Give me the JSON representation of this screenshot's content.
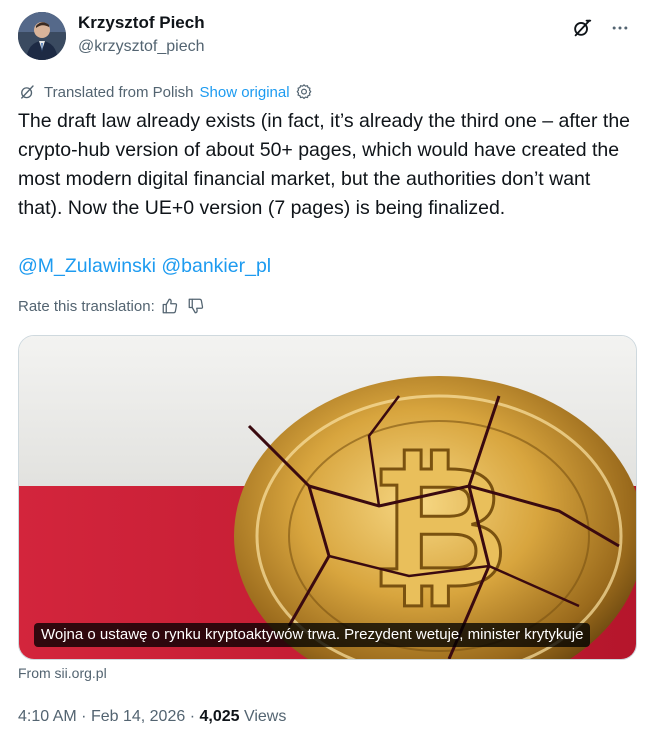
{
  "author": {
    "name": "Krzysztof Piech",
    "handle": "@krzysztof_piech"
  },
  "icons": {
    "grok": "grok-slash-icon",
    "more": "more-dots-icon",
    "translate": "translate-icon",
    "settings": "gear-icon",
    "thumbs_up": "thumbs-up-icon",
    "thumbs_down": "thumbs-down-icon"
  },
  "translation": {
    "label": "Translated from Polish",
    "show_original": "Show original",
    "rate_label": "Rate this translation:"
  },
  "tweet": {
    "text": "The draft law already exists (in fact, it’s already the third one – after the crypto-hub version of about 50+ pages, which would have created the most modern digital financial market, but the authorities don’t want that). Now the UE+0 version (7 pages) is being finalized.",
    "mentions": [
      "@M_Zulawinski",
      "@bankier_pl"
    ]
  },
  "card": {
    "caption": "Wojna o ustawę o rynku kryptoaktywów trwa. Prezydent wetuje, minister krytykuje",
    "source": "From sii.org.pl"
  },
  "meta": {
    "time": "4:10 AM",
    "separator": "·",
    "date": "Feb 14, 2026",
    "views_count": "4,025",
    "views_label": "Views"
  },
  "colors": {
    "accent": "#1d9bf0",
    "text": "#0f1419",
    "secondary": "#536471"
  }
}
